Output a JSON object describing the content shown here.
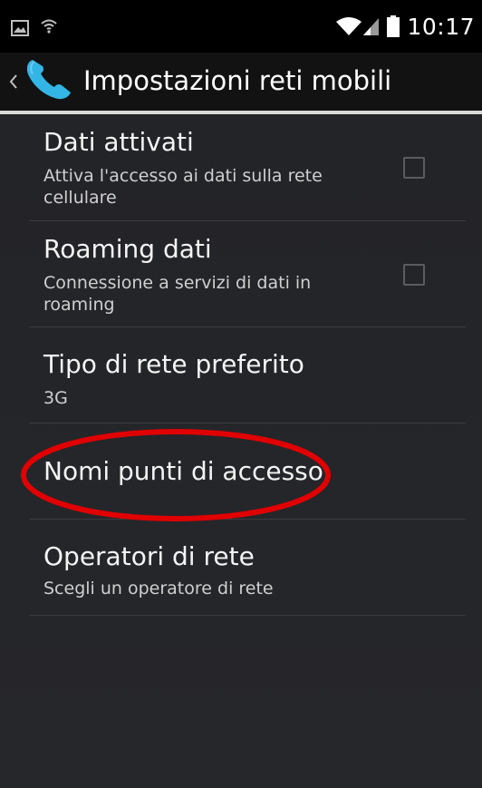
{
  "status_bar": {
    "time": "10:17",
    "icons": [
      "image-notification-icon",
      "wifi-icon",
      "wifi-signal-icon",
      "cell-signal-icon",
      "battery-icon"
    ]
  },
  "action_bar": {
    "title": "Impostazioni reti mobili",
    "app_icon": "phone-icon",
    "back_icon": "chevron-left-icon"
  },
  "preferences": [
    {
      "title": "Dati attivati",
      "summary": "Attiva l'accesso ai dati sulla rete cellulare",
      "checkbox": true,
      "checked": false
    },
    {
      "title": "Roaming dati",
      "summary": "Connessione a servizi di dati in roaming",
      "checkbox": true,
      "checked": false
    },
    {
      "title": "Tipo di rete preferito",
      "summary": "3G",
      "checkbox": false
    },
    {
      "title": "Nomi punti di accesso",
      "summary": "",
      "checkbox": false,
      "highlighted": true
    },
    {
      "title": "Operatori di rete",
      "summary": "Scegli un operatore di rete",
      "checkbox": false
    }
  ],
  "colors": {
    "background": "#26272b",
    "status_bar": "#000000",
    "action_bar": "#121212",
    "accent_phone": "#33b5e5",
    "highlight_ring": "#e00000"
  }
}
